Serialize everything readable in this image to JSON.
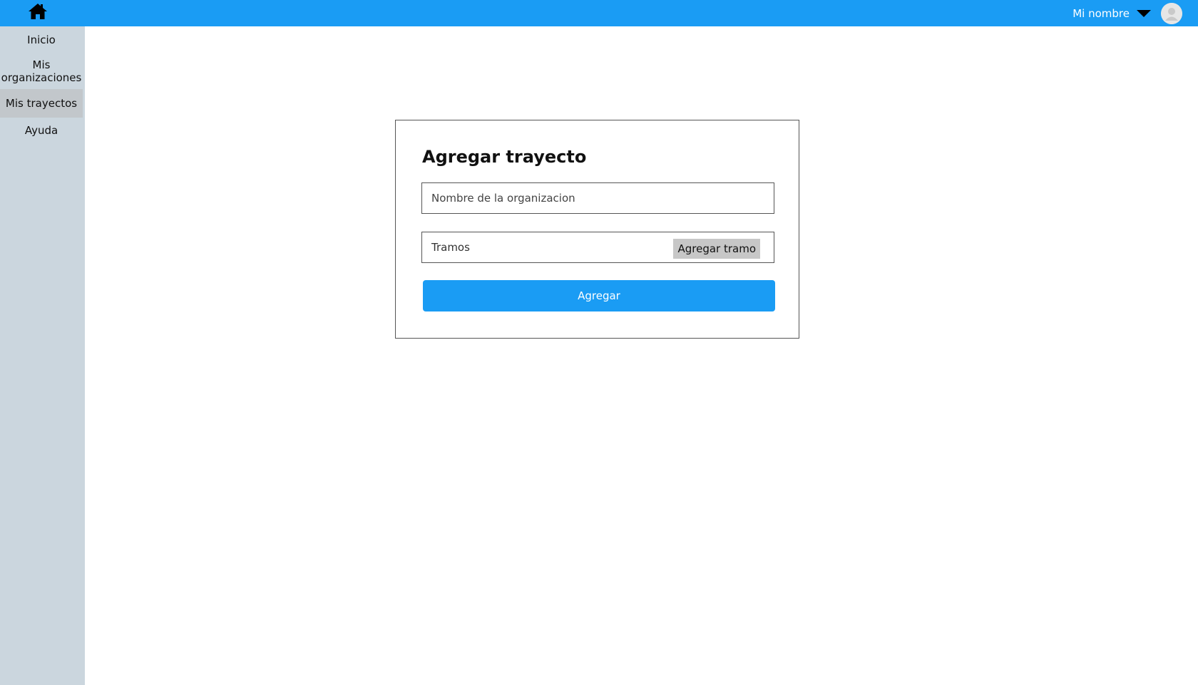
{
  "header": {
    "home_icon": "home-icon",
    "user_name": "Mi nombre",
    "dropdown_icon": "caret-down-icon",
    "avatar_icon": "user-avatar-icon",
    "bar_color": "#1a9cf4"
  },
  "sidebar": {
    "items": [
      {
        "label": "Inicio",
        "active": false
      },
      {
        "label": "Mis organizaciones",
        "active": false
      },
      {
        "label": "Mis trayectos",
        "active": true
      },
      {
        "label": "Ayuda",
        "active": false
      }
    ]
  },
  "form": {
    "title": "Agregar trayecto",
    "org_placeholder": "Nombre de la organizacion",
    "org_value": "",
    "tramos_label": "Tramos",
    "add_tramo_label": "Agregar tramo",
    "submit_label": "Agregar"
  }
}
